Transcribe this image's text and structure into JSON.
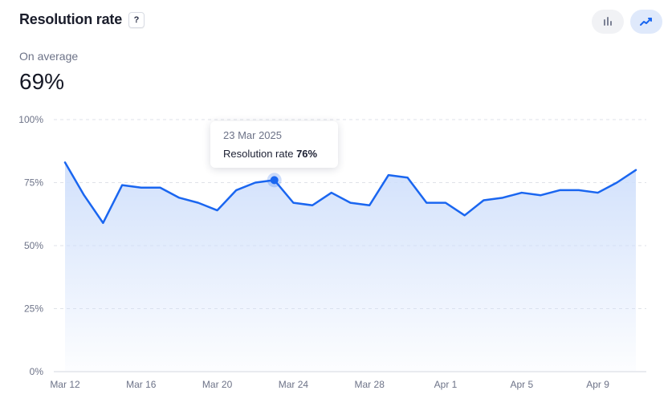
{
  "header": {
    "title": "Resolution rate",
    "help_label": "?"
  },
  "view_toggle": {
    "bar_icon": "bar-chart-icon",
    "line_icon": "line-chart-icon",
    "active": "line",
    "accent": "#1a66f0"
  },
  "summary": {
    "label": "On average",
    "value": "69%"
  },
  "tooltip": {
    "date": "23 Mar 2025",
    "metric_label": "Resolution rate",
    "metric_value": "76%",
    "point_index": 11
  },
  "chart_data": {
    "type": "area",
    "title": "Resolution rate",
    "x": [
      "2025-03-12",
      "2025-03-13",
      "2025-03-14",
      "2025-03-15",
      "2025-03-16",
      "2025-03-17",
      "2025-03-18",
      "2025-03-19",
      "2025-03-20",
      "2025-03-21",
      "2025-03-22",
      "2025-03-23",
      "2025-03-24",
      "2025-03-25",
      "2025-03-26",
      "2025-03-27",
      "2025-03-28",
      "2025-03-29",
      "2025-03-30",
      "2025-03-31",
      "2025-04-01",
      "2025-04-02",
      "2025-04-03",
      "2025-04-04",
      "2025-04-05",
      "2025-04-06",
      "2025-04-07",
      "2025-04-08",
      "2025-04-09",
      "2025-04-10",
      "2025-04-11"
    ],
    "x_tick_labels": [
      "Mar 12",
      "Mar 16",
      "Mar 20",
      "Mar 24",
      "Mar 28",
      "Apr 1",
      "Apr 5",
      "Apr 9"
    ],
    "x_tick_indices": [
      0,
      4,
      8,
      12,
      16,
      20,
      24,
      28
    ],
    "series": [
      {
        "values": [
          83,
          70,
          59,
          74,
          73,
          73,
          69,
          67,
          64,
          72,
          75,
          76,
          67,
          66,
          71,
          67,
          66,
          78,
          77,
          67,
          67,
          62,
          68,
          69,
          71,
          70,
          72,
          72,
          71,
          75,
          80
        ],
        "color": "#1a66f0"
      }
    ],
    "y_ticks": [
      0,
      25,
      50,
      75,
      100
    ],
    "y_tick_labels": [
      "0%",
      "25%",
      "50%",
      "75%",
      "100%"
    ],
    "ylim": [
      0,
      100
    ],
    "grid": true,
    "legend": "none",
    "fill_color": "#d7e5fc"
  }
}
